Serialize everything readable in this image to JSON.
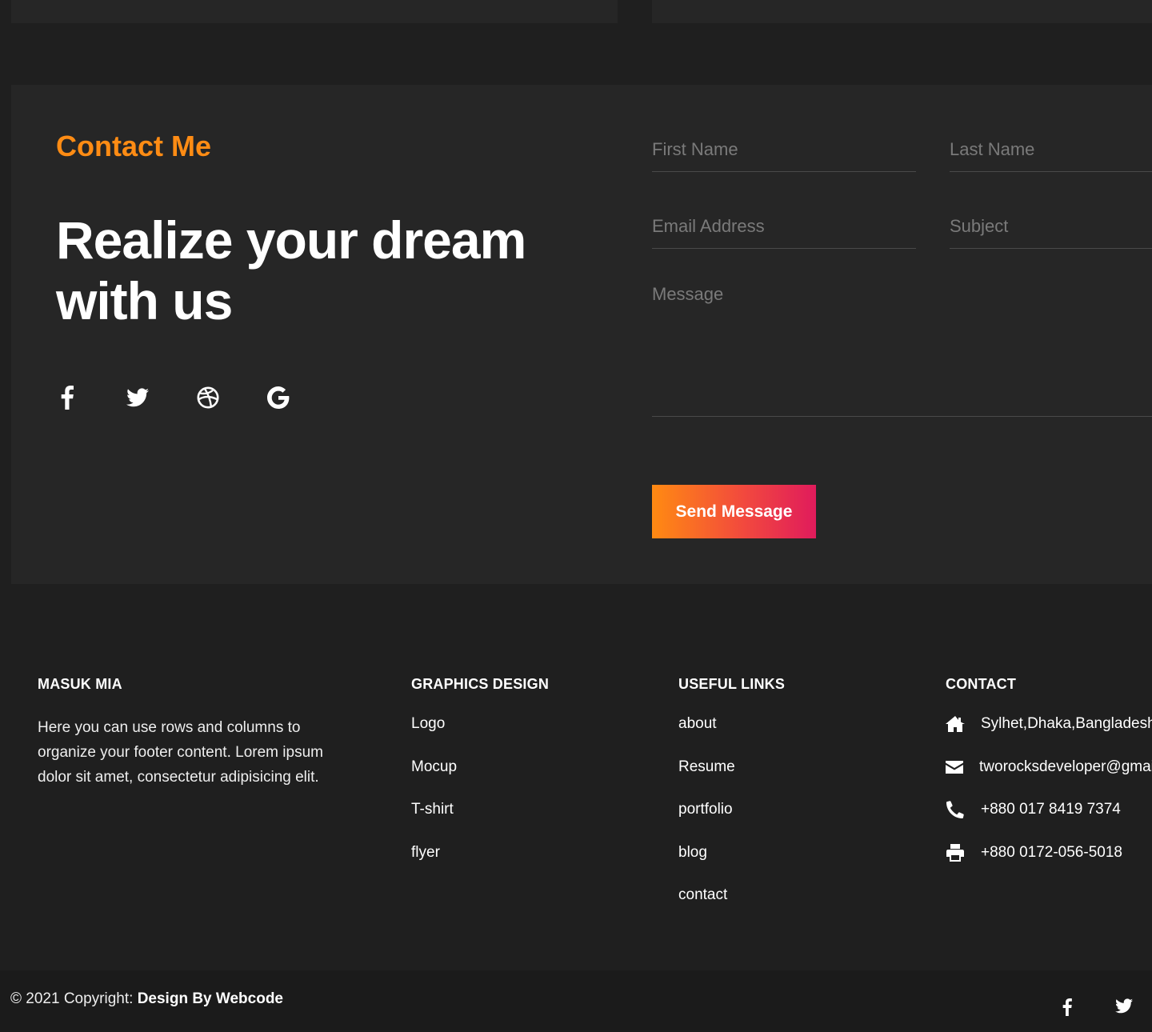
{
  "contact": {
    "kicker": "Contact Me",
    "headline": "Realize your dream with us",
    "social_icons": [
      "facebook-icon",
      "twitter-icon",
      "dribbble-icon",
      "google-icon"
    ],
    "form": {
      "first_name_placeholder": "First Name",
      "last_name_placeholder": "Last Name",
      "email_placeholder": "Email Address",
      "subject_placeholder": "Subject",
      "message_placeholder": "Message",
      "submit_label": "Send Message"
    }
  },
  "footer": {
    "about": {
      "heading": "MASUK MIA",
      "text": "Here you can use rows and columns to organize your footer content. Lorem ipsum dolor sit amet, consectetur adipisicing elit."
    },
    "graphics": {
      "heading": "GRAPHICS DESIGN",
      "links": [
        "Logo",
        "Mocup",
        "T-shirt",
        "flyer"
      ]
    },
    "useful": {
      "heading": "USEFUL LINKS",
      "links": [
        "about",
        "Resume",
        "portfolio",
        "blog",
        "contact"
      ]
    },
    "contact": {
      "heading": "CONTACT",
      "items": [
        {
          "icon": "home-icon",
          "text": "Sylhet,Dhaka,Bangladesh"
        },
        {
          "icon": "envelope-icon",
          "text": "tworocksdeveloper@gmail.com"
        },
        {
          "icon": "phone-icon",
          "text": "+880 017 8419 7374"
        },
        {
          "icon": "print-icon",
          "text": "+880 0172-056-5018"
        }
      ]
    }
  },
  "bottom": {
    "copyright_prefix": "© 2021 Copyright: ",
    "copyright_credit": "Design By Webcode",
    "social_icons": [
      "facebook-icon",
      "twitter-icon"
    ]
  },
  "colors": {
    "accent": "#ff8c14",
    "button_gradient_start": "#ff8a12",
    "button_gradient_end": "#e01b5c",
    "background": "#1f1f1f",
    "panel": "#262626"
  }
}
